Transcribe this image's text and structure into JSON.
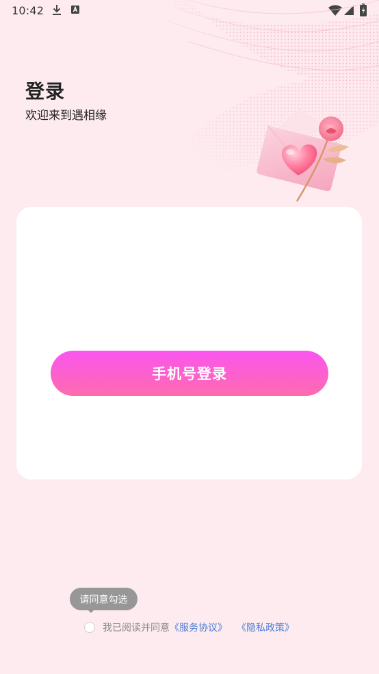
{
  "status_bar": {
    "time": "10:42"
  },
  "header": {
    "title": "登录",
    "subtitle": "欢迎来到遇相缘"
  },
  "login": {
    "phone_button_label": "手机号登录"
  },
  "agreement": {
    "tooltip": "请同意勾选",
    "text": "我已阅读并同意",
    "service_link": "《服务协议》",
    "privacy_link": "《隐私政策》",
    "checked": false
  },
  "colors": {
    "background": "#fdebef",
    "button_gradient_top": "#fb55f0",
    "button_gradient_bottom": "#fe6bad",
    "link": "#4a7fd8"
  }
}
